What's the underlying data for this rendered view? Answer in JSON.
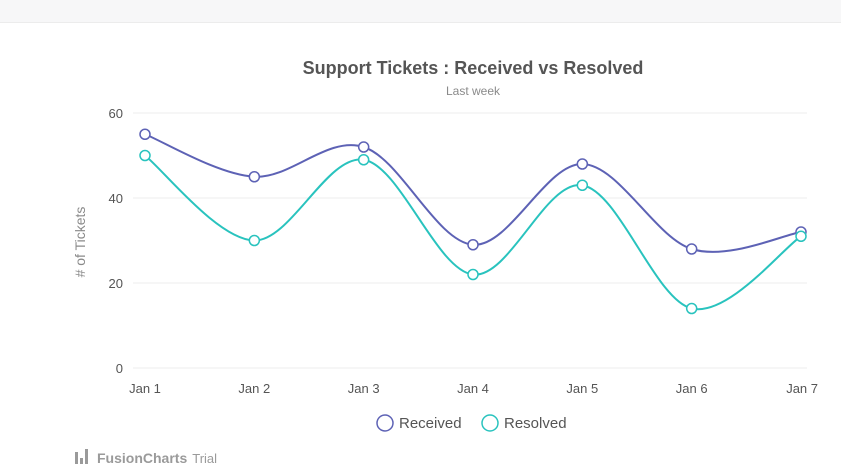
{
  "chart_data": {
    "type": "line",
    "title": "Support Tickets : Received vs Resolved",
    "subtitle": "Last week",
    "xlabel": "",
    "ylabel": "# of Tickets",
    "categories": [
      "Jan 1",
      "Jan 2",
      "Jan 3",
      "Jan 4",
      "Jan 5",
      "Jan 6",
      "Jan 7"
    ],
    "ylim": [
      0,
      60
    ],
    "yticks": [
      0,
      20,
      40,
      60
    ],
    "grid": true,
    "legend_position": "bottom-center",
    "series": [
      {
        "name": "Received",
        "color": "#5d62b5",
        "values": [
          55,
          45,
          52,
          29,
          48,
          28,
          32
        ]
      },
      {
        "name": "Resolved",
        "color": "#29c3be",
        "values": [
          50,
          30,
          49,
          22,
          43,
          14,
          31
        ]
      }
    ]
  },
  "watermark": {
    "brand": "FusionCharts",
    "suffix": "Trial",
    "icon": "fusioncharts-logo-icon"
  }
}
